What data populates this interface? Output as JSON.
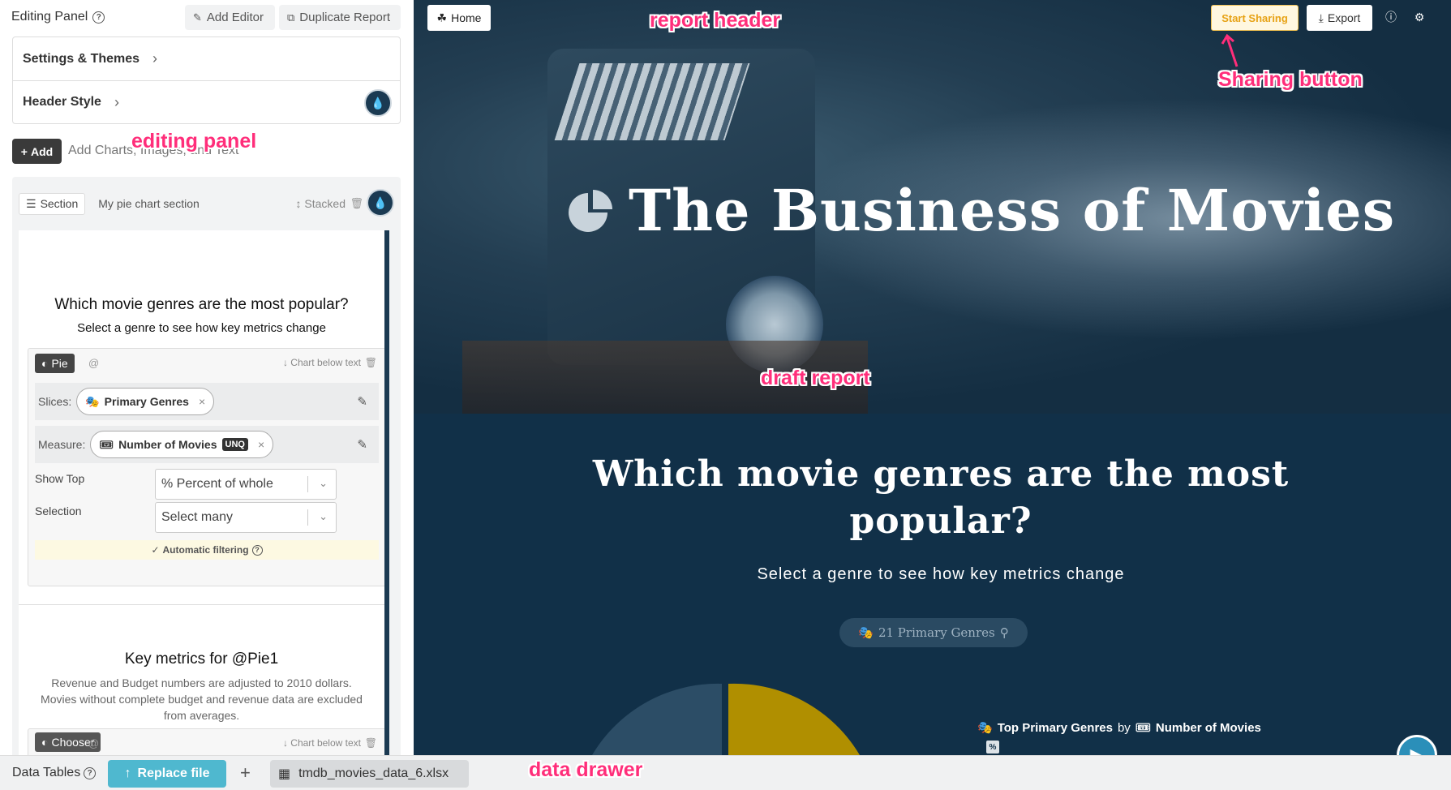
{
  "editing_panel": {
    "title": "Editing Panel",
    "add_editor": "Add Editor",
    "duplicate_report": "Duplicate Report",
    "settings_themes": "Settings & Themes",
    "header_style": "Header Style",
    "add_button": "Add",
    "add_hint": "Add Charts, Images, and Text"
  },
  "section": {
    "tag": "Section",
    "name": "My pie chart section",
    "layout": "Stacked",
    "question_title": "Which movie genres are the most popular?",
    "question_subtitle": "Select a genre to see how key metrics change",
    "chart_type": "Pie",
    "at_symbol": "@",
    "chart_position": "Chart below text",
    "slices_label": "Slices:",
    "slices_value": "Primary Genres",
    "measure_label": "Measure:",
    "measure_value": "Number of Movies",
    "measure_badge": "UNQ",
    "show_top_label": "Show Top",
    "show_top_value": "% Percent of whole",
    "selection_label": "Selection",
    "selection_value": "Select many",
    "auto_filter": "Automatic filtering",
    "key_metrics_title": "Key metrics for @Pie1",
    "key_metrics_text": "Revenue and Budget numbers are adjusted to 2010 dollars. Movies without complete budget and revenue data are excluded from averages.",
    "chooser_type": "Chooser",
    "chooser_position": "Chart below text"
  },
  "report": {
    "home": "Home",
    "start_sharing": "Start Sharing",
    "export": "Export",
    "title": "The Business of Movies",
    "section_title": "Which movie genres are the most popular?",
    "section_subtitle": "Select a genre to see how key metrics change",
    "genre_filter": "21 Primary Genres",
    "legend_dimension": "Top Primary Genres",
    "legend_by": "by",
    "legend_measure": "Number of Movies",
    "pie_colors": [
      "#2c4d66",
      "#b08f00"
    ]
  },
  "drawer": {
    "label": "Data Tables",
    "replace_file": "Replace file",
    "file_name": "tmdb_movies_data_6.xlsx"
  },
  "annotations": {
    "report_header": "report header",
    "sharing_button": "Sharing button",
    "editing_panel": "editing panel",
    "draft_report": "draft report",
    "data_drawer": "data drawer"
  }
}
